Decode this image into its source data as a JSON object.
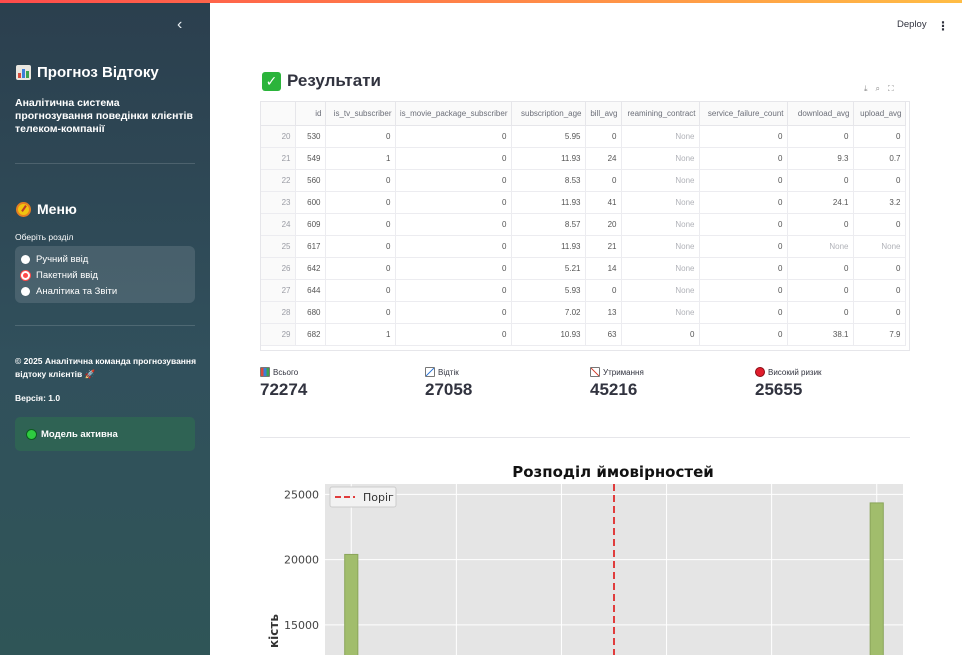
{
  "sidebar": {
    "title": "Прогноз Відтоку",
    "subtitle": "Аналітична система прогнозування поведінки клієнтів телеком-компанії",
    "menu_title": "Меню",
    "menu_label": "Оберіть розділ",
    "options": [
      "Ручний ввід",
      "Пакетний ввід",
      "Аналітика та Звіти"
    ],
    "selected_option": "Пакетний ввід",
    "footer": "© 2025 Аналітична команда прогнозування відтоку клієнтів 🚀",
    "version": "Версія: 1.0",
    "status": "Модель активна"
  },
  "header": {
    "deploy": "Deploy",
    "menu_icon": "⋮"
  },
  "main": {
    "results_title": "Результати",
    "table": {
      "columns": [
        "id",
        "is_tv_subscriber",
        "is_movie_package_subscriber",
        "subscription_age",
        "bill_avg",
        "reamining_contract",
        "service_failure_count",
        "download_avg",
        "upload_avg"
      ],
      "rows": [
        [
          "20",
          "530",
          "0",
          "0",
          "5.95",
          "0",
          "None",
          "0",
          "0",
          "0"
        ],
        [
          "21",
          "549",
          "1",
          "0",
          "11.93",
          "24",
          "None",
          "0",
          "9.3",
          "0.7"
        ],
        [
          "22",
          "560",
          "0",
          "0",
          "8.53",
          "0",
          "None",
          "0",
          "0",
          "0"
        ],
        [
          "23",
          "600",
          "0",
          "0",
          "11.93",
          "41",
          "None",
          "0",
          "24.1",
          "3.2"
        ],
        [
          "24",
          "609",
          "0",
          "0",
          "8.57",
          "20",
          "None",
          "0",
          "0",
          "0"
        ],
        [
          "25",
          "617",
          "0",
          "0",
          "11.93",
          "21",
          "None",
          "0",
          "None",
          "None"
        ],
        [
          "26",
          "642",
          "0",
          "0",
          "5.21",
          "14",
          "None",
          "0",
          "0",
          "0"
        ],
        [
          "27",
          "644",
          "0",
          "0",
          "5.93",
          "0",
          "None",
          "0",
          "0",
          "0"
        ],
        [
          "28",
          "680",
          "0",
          "0",
          "7.02",
          "13",
          "None",
          "0",
          "0",
          "0"
        ],
        [
          "29",
          "682",
          "1",
          "0",
          "10.93",
          "63",
          "0",
          "0",
          "38.1",
          "7.9"
        ]
      ]
    },
    "metrics": [
      {
        "label": "Всього",
        "value": "72274",
        "icon": "bar-chart-icon"
      },
      {
        "label": "Відтік",
        "value": "27058",
        "icon": "trend-down-icon"
      },
      {
        "label": "Утримання",
        "value": "45216",
        "icon": "trend-up-icon"
      },
      {
        "label": "Високий ризик",
        "value": "25655",
        "icon": "red-circle-icon"
      }
    ]
  },
  "chart_data": {
    "type": "bar",
    "title": "Розподіл ймовірностей",
    "ylabel": "кість",
    "ylim": [
      12000,
      25800
    ],
    "yticks": [
      15000,
      20000,
      25000
    ],
    "bars": [
      {
        "x": 0.0,
        "value": 20400
      },
      {
        "x": 1.0,
        "value": 24350
      }
    ],
    "threshold": 0.5,
    "legend": "Поріг",
    "legend_position": "top-left",
    "bar_color": "#a1bd6c",
    "threshold_color": "#e03c3c",
    "grid": true
  }
}
